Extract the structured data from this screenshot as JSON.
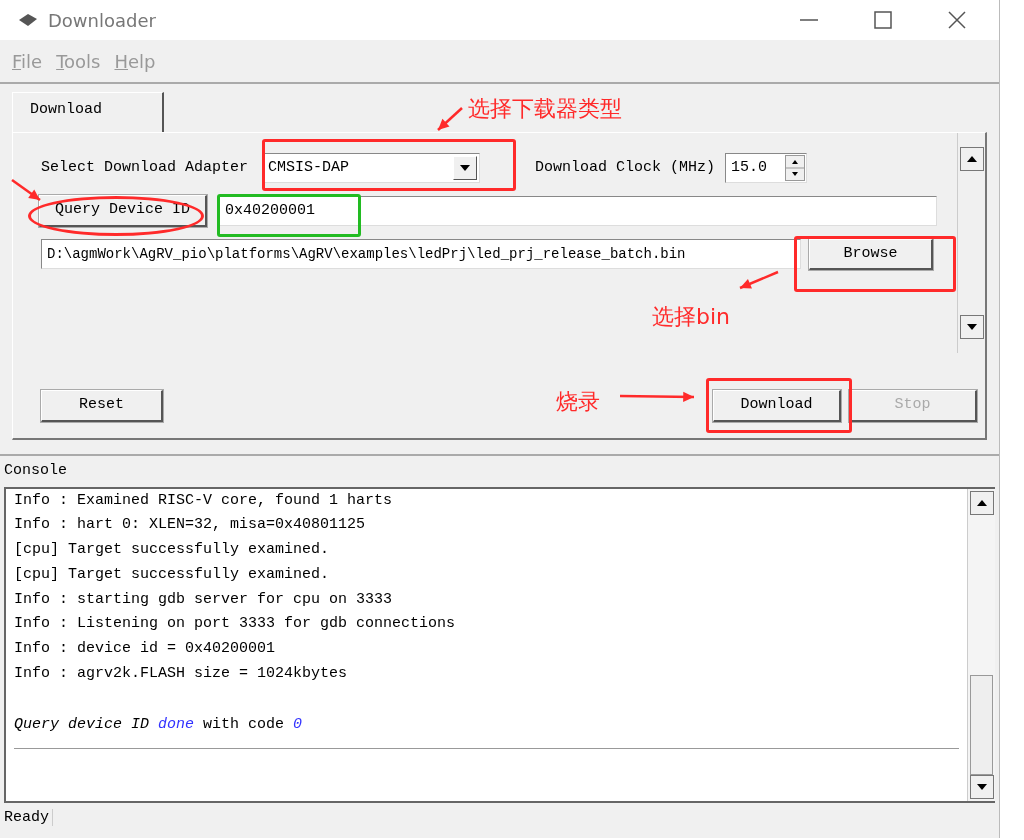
{
  "window": {
    "title": "Downloader"
  },
  "menu": [
    {
      "label": "File"
    },
    {
      "label": "Tools"
    },
    {
      "label": "Help"
    }
  ],
  "tabs": [
    {
      "label": "Download",
      "selected": true
    }
  ],
  "adapter": {
    "label": "Select Download Adapter",
    "value": "CMSIS-DAP"
  },
  "clock": {
    "label": "Download Clock (MHz)",
    "value": "15.0"
  },
  "query": {
    "button": "Query Device ID",
    "value": "0x40200001"
  },
  "file": {
    "value": "D:\\agmWork\\AgRV_pio\\platforms\\AgRV\\examples\\ledPrj\\led_prj_release_batch.bin",
    "button": "Browse"
  },
  "buttons": [
    {
      "label": "Reset",
      "disabled": false
    },
    {
      "label": "Download",
      "disabled": false
    },
    {
      "label": "Stop",
      "disabled": true
    }
  ],
  "console": {
    "title": "Console",
    "lines": [
      [
        {
          "text": "Info : Examined RISC-V core, found 1 harts",
          "italic": false
        }
      ],
      [
        {
          "text": "Info :  hart 0: XLEN=32, misa=0x40801125",
          "italic": false
        }
      ],
      [
        {
          "text": "[cpu] Target successfully examined.",
          "italic": false
        }
      ],
      [
        {
          "text": "[cpu] Target successfully examined.",
          "italic": false
        }
      ],
      [
        {
          "text": "Info : starting gdb server for cpu on 3333",
          "italic": false
        }
      ],
      [
        {
          "text": "Info : Listening on port 3333 for gdb connections",
          "italic": false
        }
      ],
      [
        {
          "text": "Info : device id = 0x40200001",
          "italic": false
        }
      ],
      [
        {
          "text": "Info : agrv2k.FLASH size = 1024kbytes",
          "italic": false
        }
      ],
      {
        "kind": "result",
        "segments": [
          {
            "text": "Query device ID",
            "italic": true
          },
          {
            "text": "done",
            "italic": true,
            "color": "#3333ff"
          },
          {
            "text": "with code",
            "italic": false
          },
          {
            "text": "0",
            "italic": true,
            "color": "#3333ff"
          }
        ]
      }
    ]
  },
  "status_bar": {
    "text": "Ready"
  },
  "annotations": [
    {
      "kind": "note",
      "text": "选择下载器类型"
    },
    {
      "kind": "note",
      "text": "选择bin"
    },
    {
      "kind": "note",
      "text": "烧录"
    }
  ]
}
